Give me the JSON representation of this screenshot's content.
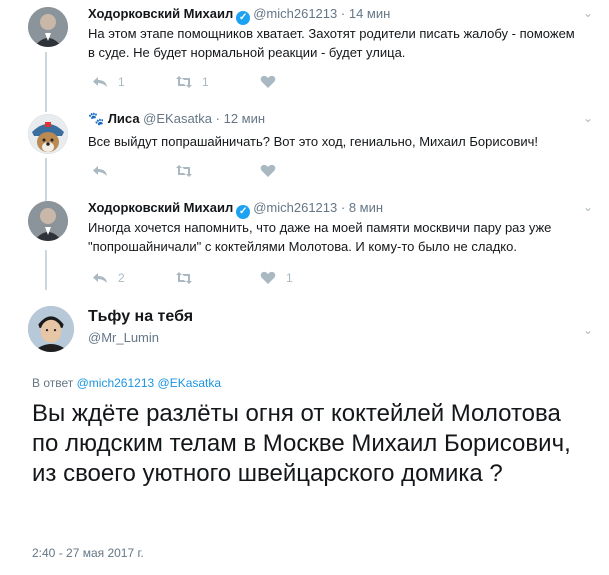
{
  "tweets": [
    {
      "name": "Ходорковский Михаил",
      "verified": true,
      "handle": "@mich261213",
      "time": "14 мин",
      "text": "На этом этапе помощников хватает. Захотят родители писать жалобу - поможем в суде. Не будет нормальной реакции - будет улица.",
      "replies": "1",
      "retweets": "1",
      "likes": ""
    },
    {
      "name": "Лиса",
      "name_prefix": "🐾",
      "verified": false,
      "handle": "@EKasatka",
      "time": "12 мин",
      "text": "Все выйдут попрашайничать?  Вот это ход, гениально, Михаил Борисович!",
      "replies": "",
      "retweets": "",
      "likes": ""
    },
    {
      "name": "Ходорковский Михаил",
      "verified": true,
      "handle": "@mich261213",
      "time": "8 мин",
      "text": "Иногда хочется напомнить, что даже на моей памяти москвичи пару раз уже \"попрошайничали\" с коктейлями Молотова. И кому-то было не сладко.",
      "replies": "2",
      "retweets": "",
      "likes": "1"
    }
  ],
  "focus": {
    "name": "Тьфу на тебя",
    "handle": "@Mr_Lumin",
    "reply_prefix": "В ответ",
    "reply_to_1": "@mich261213",
    "reply_to_2": "@EKasatka",
    "text": "Вы ждёте разлёты огня от коктейлей Молотова по людским телам в Москве Михаил Борисович, из своего уютного швейцарского домика ?",
    "timestamp": "2:40 - 27 мая 2017 г."
  },
  "separator": "·",
  "colors": {
    "accent": "#1da1f2",
    "link": "#1b95e0",
    "muted": "#657786",
    "icon": "#aab8c2",
    "thread_line": "#ccd6dd"
  }
}
